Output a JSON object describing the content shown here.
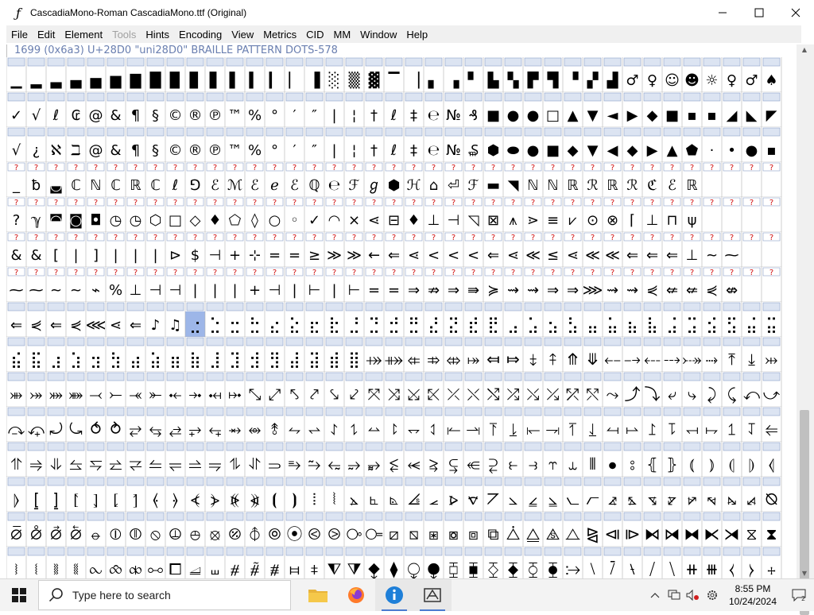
{
  "window": {
    "title": "CascadiaMono-Roman  CascadiaMono.ttf (Original)",
    "minimize_glyph": "—",
    "maximize_glyph": "☐",
    "close_glyph": "✕"
  },
  "menu": [
    {
      "label": "File",
      "enabled": true
    },
    {
      "label": "Edit",
      "enabled": true
    },
    {
      "label": "Element",
      "enabled": true
    },
    {
      "label": "Tools",
      "enabled": false
    },
    {
      "label": "Hints",
      "enabled": true
    },
    {
      "label": "Encoding",
      "enabled": true
    },
    {
      "label": "View",
      "enabled": true
    },
    {
      "label": "Metrics",
      "enabled": true
    },
    {
      "label": "CID",
      "enabled": true
    },
    {
      "label": "MM",
      "enabled": true
    },
    {
      "label": "Window",
      "enabled": true
    },
    {
      "label": "Help",
      "enabled": true
    }
  ],
  "glyph_info": "1699 (0x6a3) U+28D0 \"uni28D0\" BRAILLE PATTERN DOTS-578",
  "font_view": {
    "columns": 39,
    "header_rows": [
      "▁▂▃▄▅▆▇█▉▊▋▌▍▎▏▐░▒▓▔▕▖▗▘▙▚▛▜▝▞▟♂♀☺☻☼♀♂♠♣♥♦",
      "✓√ℓ₢@&¶§©®℗™%°′″|¦†ℓ‡℮№₰■●●□▲▼◄▶◆■▪▪◢◣◤◥◦▫▸"
    ],
    "sample_rows": [
      "√¿ℵℶ@&¶§©®℗™%°′″|¦†ℓ‡℮№₷⬢⬬●■◆▼◀◆▶▲⬟·•●▪",
      "_ƀ◛ℂℕℂℝℂℓ⅁ℰℳℰℯℰℚ℮ℱℊ⬢ℋ⌂⏎ℱ▬◥ℕℕℝℛℝℛℭℰℝ",
      "?ℽ◚◙◘◷◷⬡□◇♦⬠◊○◦✓◠⨯⋖⊟♦⊥⊣◹⊠⩚⋗≡⩗⊙⊗⌈⊥⊓ψ",
      "&&[|]|||⊳$⊣+⊹==≥≫≫←⇐⋖<<<⇐⋖≪≤⋖≪≪⇐⇐⇐⊥~⁓",
      "⁓⁓~~⌁%⊥⊣⊣|||+⊣|⊢|⊢==⇒⇏⇒⇛≽⇝⇝⇒⇒⋙⇝⇝⋞⇍⇍⋞⇎",
      "⇐⋞⇐⋞⋘⋖⇐♪♫"
    ],
    "braille_start": 10448,
    "selected_codepoint": 10448,
    "missing_mark": "?"
  },
  "taskbar": {
    "search_placeholder": "Type here to search",
    "time": "8:55 PM",
    "date": "10/24/2024"
  }
}
